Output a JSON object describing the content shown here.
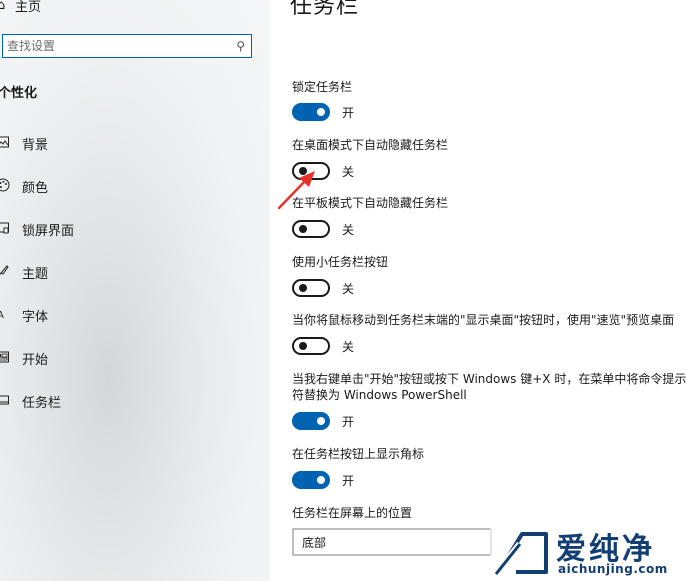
{
  "sidebar": {
    "home_label": "主页",
    "search": {
      "value": "",
      "placeholder": "查找设置"
    },
    "section_title": "个性化",
    "items": [
      {
        "label": "背景",
        "icon": "image-icon"
      },
      {
        "label": "颜色",
        "icon": "palette-icon"
      },
      {
        "label": "锁屏界面",
        "icon": "lock-screen-icon"
      },
      {
        "label": "主题",
        "icon": "brush-icon"
      },
      {
        "label": "字体",
        "icon": "font-icon"
      },
      {
        "label": "开始",
        "icon": "start-icon"
      },
      {
        "label": "任务栏",
        "icon": "taskbar-icon"
      }
    ]
  },
  "main": {
    "title": "任务栏",
    "settings": [
      {
        "label": "锁定任务栏",
        "state": "开",
        "on": true
      },
      {
        "label": "在桌面模式下自动隐藏任务栏",
        "state": "关",
        "on": false
      },
      {
        "label": "在平板模式下自动隐藏任务栏",
        "state": "关",
        "on": false
      },
      {
        "label": "使用小任务栏按钮",
        "state": "关",
        "on": false
      },
      {
        "label": "当你将鼠标移动到任务栏末端的\"显示桌面\"按钮时，使用\"速览\"预览桌面",
        "state": "关",
        "on": false
      },
      {
        "label": "当我右键单击\"开始\"按钮或按下 Windows 键+X 时，在菜单中将命令提示符替换为 Windows PowerShell",
        "state": "开",
        "on": true
      },
      {
        "label": "在任务栏按钮上显示角标",
        "state": "开",
        "on": true
      }
    ],
    "position_label": "任务栏在屏幕上的位置",
    "position_value": "底部"
  },
  "watermark": {
    "brand": "爱纯净",
    "url": "aichunjing.com"
  },
  "colors": {
    "accent": "#0063b1",
    "watermark": "#123e73",
    "arrow": "#e8302a"
  }
}
